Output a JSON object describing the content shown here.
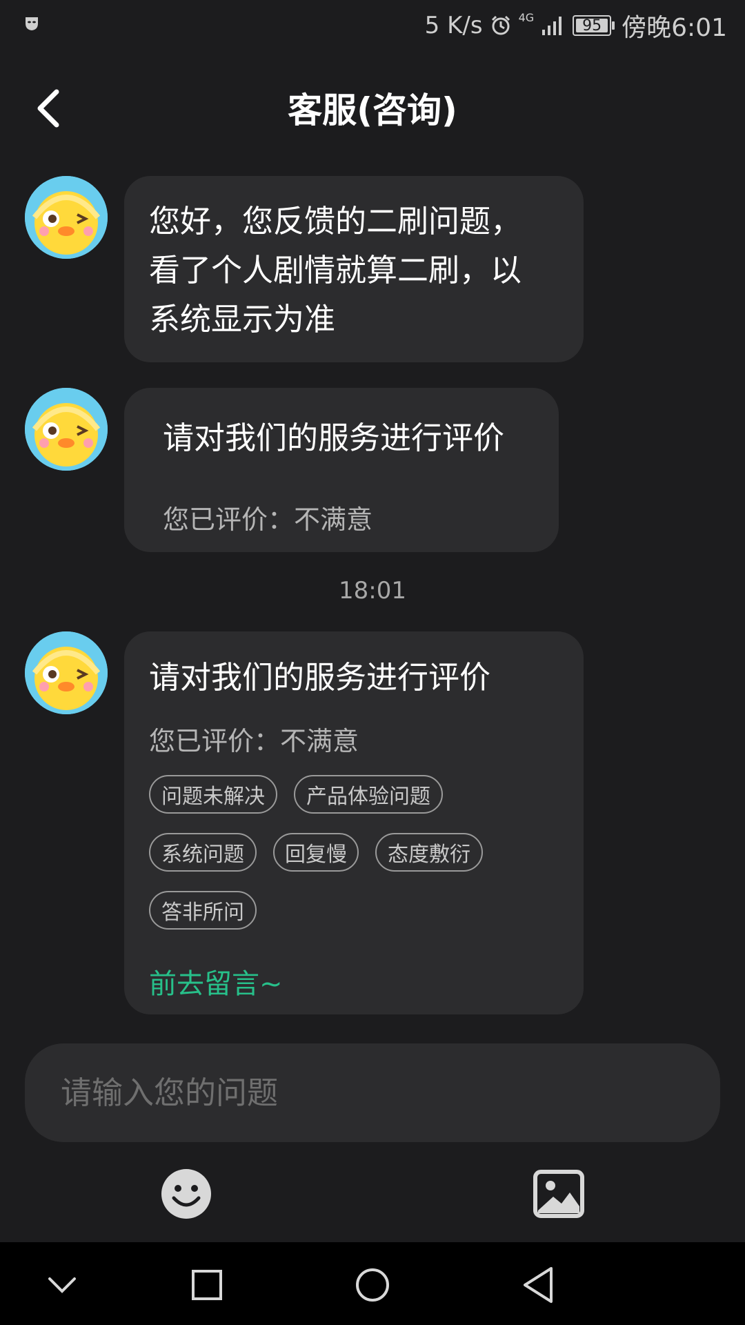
{
  "status_bar": {
    "net_speed": "5 K/s",
    "network": "4G",
    "battery": "95",
    "time": "傍晚6:01"
  },
  "header": {
    "title": "客服(咨询)"
  },
  "messages": [
    {
      "text_lines": [
        "您好，您反馈的二刷问题，",
        "看了个人剧情就算二刷，以",
        "系统显示为准"
      ]
    },
    {
      "title": "请对我们的服务进行评价",
      "status": "您已评价：不满意"
    }
  ],
  "timestamp": "18:01",
  "evaluation_card": {
    "title": "请对我们的服务进行评价",
    "status": "您已评价：不满意",
    "tags": [
      "问题未解决",
      "产品体验问题",
      "系统问题",
      "回复慢",
      "态度敷衍",
      "答非所问"
    ],
    "leave_message": "前去留言~",
    "accent_color": "#27c08a"
  },
  "input": {
    "placeholder": "请输入您的问题"
  },
  "toolbar": {
    "icons": [
      "emoji-icon",
      "image-icon"
    ]
  },
  "nav_bar": {
    "icons": [
      "chevron-down-icon",
      "square-icon",
      "circle-icon",
      "triangle-back-icon"
    ]
  }
}
